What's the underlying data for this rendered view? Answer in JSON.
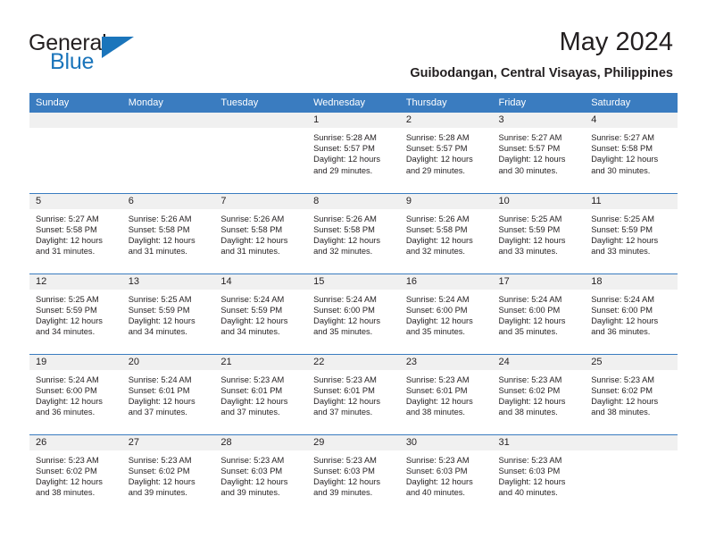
{
  "brand": {
    "line1": "General",
    "line2": "Blue",
    "flag_color": "#1b75bb"
  },
  "header": {
    "title": "May 2024",
    "subtitle": "Guibodangan, Central Visayas, Philippines",
    "accent_color": "#3a7cc0",
    "daynum_bg": "#f0f0f0"
  },
  "weekday_headers": [
    "Sunday",
    "Monday",
    "Tuesday",
    "Wednesday",
    "Thursday",
    "Friday",
    "Saturday"
  ],
  "labels": {
    "sunrise_prefix": "Sunrise:",
    "sunset_prefix": "Sunset:",
    "daylight_prefix": "Daylight:"
  },
  "weeks": [
    [
      {
        "day": "",
        "empty": true
      },
      {
        "day": "",
        "empty": true
      },
      {
        "day": "",
        "empty": true
      },
      {
        "day": "1",
        "sunrise": "Sunrise: 5:28 AM",
        "sunset": "Sunset: 5:57 PM",
        "daylight": "Daylight: 12 hours and 29 minutes."
      },
      {
        "day": "2",
        "sunrise": "Sunrise: 5:28 AM",
        "sunset": "Sunset: 5:57 PM",
        "daylight": "Daylight: 12 hours and 29 minutes."
      },
      {
        "day": "3",
        "sunrise": "Sunrise: 5:27 AM",
        "sunset": "Sunset: 5:57 PM",
        "daylight": "Daylight: 12 hours and 30 minutes."
      },
      {
        "day": "4",
        "sunrise": "Sunrise: 5:27 AM",
        "sunset": "Sunset: 5:58 PM",
        "daylight": "Daylight: 12 hours and 30 minutes."
      }
    ],
    [
      {
        "day": "5",
        "sunrise": "Sunrise: 5:27 AM",
        "sunset": "Sunset: 5:58 PM",
        "daylight": "Daylight: 12 hours and 31 minutes."
      },
      {
        "day": "6",
        "sunrise": "Sunrise: 5:26 AM",
        "sunset": "Sunset: 5:58 PM",
        "daylight": "Daylight: 12 hours and 31 minutes."
      },
      {
        "day": "7",
        "sunrise": "Sunrise: 5:26 AM",
        "sunset": "Sunset: 5:58 PM",
        "daylight": "Daylight: 12 hours and 31 minutes."
      },
      {
        "day": "8",
        "sunrise": "Sunrise: 5:26 AM",
        "sunset": "Sunset: 5:58 PM",
        "daylight": "Daylight: 12 hours and 32 minutes."
      },
      {
        "day": "9",
        "sunrise": "Sunrise: 5:26 AM",
        "sunset": "Sunset: 5:58 PM",
        "daylight": "Daylight: 12 hours and 32 minutes."
      },
      {
        "day": "10",
        "sunrise": "Sunrise: 5:25 AM",
        "sunset": "Sunset: 5:59 PM",
        "daylight": "Daylight: 12 hours and 33 minutes."
      },
      {
        "day": "11",
        "sunrise": "Sunrise: 5:25 AM",
        "sunset": "Sunset: 5:59 PM",
        "daylight": "Daylight: 12 hours and 33 minutes."
      }
    ],
    [
      {
        "day": "12",
        "sunrise": "Sunrise: 5:25 AM",
        "sunset": "Sunset: 5:59 PM",
        "daylight": "Daylight: 12 hours and 34 minutes."
      },
      {
        "day": "13",
        "sunrise": "Sunrise: 5:25 AM",
        "sunset": "Sunset: 5:59 PM",
        "daylight": "Daylight: 12 hours and 34 minutes."
      },
      {
        "day": "14",
        "sunrise": "Sunrise: 5:24 AM",
        "sunset": "Sunset: 5:59 PM",
        "daylight": "Daylight: 12 hours and 34 minutes."
      },
      {
        "day": "15",
        "sunrise": "Sunrise: 5:24 AM",
        "sunset": "Sunset: 6:00 PM",
        "daylight": "Daylight: 12 hours and 35 minutes."
      },
      {
        "day": "16",
        "sunrise": "Sunrise: 5:24 AM",
        "sunset": "Sunset: 6:00 PM",
        "daylight": "Daylight: 12 hours and 35 minutes."
      },
      {
        "day": "17",
        "sunrise": "Sunrise: 5:24 AM",
        "sunset": "Sunset: 6:00 PM",
        "daylight": "Daylight: 12 hours and 35 minutes."
      },
      {
        "day": "18",
        "sunrise": "Sunrise: 5:24 AM",
        "sunset": "Sunset: 6:00 PM",
        "daylight": "Daylight: 12 hours and 36 minutes."
      }
    ],
    [
      {
        "day": "19",
        "sunrise": "Sunrise: 5:24 AM",
        "sunset": "Sunset: 6:00 PM",
        "daylight": "Daylight: 12 hours and 36 minutes."
      },
      {
        "day": "20",
        "sunrise": "Sunrise: 5:24 AM",
        "sunset": "Sunset: 6:01 PM",
        "daylight": "Daylight: 12 hours and 37 minutes."
      },
      {
        "day": "21",
        "sunrise": "Sunrise: 5:23 AM",
        "sunset": "Sunset: 6:01 PM",
        "daylight": "Daylight: 12 hours and 37 minutes."
      },
      {
        "day": "22",
        "sunrise": "Sunrise: 5:23 AM",
        "sunset": "Sunset: 6:01 PM",
        "daylight": "Daylight: 12 hours and 37 minutes."
      },
      {
        "day": "23",
        "sunrise": "Sunrise: 5:23 AM",
        "sunset": "Sunset: 6:01 PM",
        "daylight": "Daylight: 12 hours and 38 minutes."
      },
      {
        "day": "24",
        "sunrise": "Sunrise: 5:23 AM",
        "sunset": "Sunset: 6:02 PM",
        "daylight": "Daylight: 12 hours and 38 minutes."
      },
      {
        "day": "25",
        "sunrise": "Sunrise: 5:23 AM",
        "sunset": "Sunset: 6:02 PM",
        "daylight": "Daylight: 12 hours and 38 minutes."
      }
    ],
    [
      {
        "day": "26",
        "sunrise": "Sunrise: 5:23 AM",
        "sunset": "Sunset: 6:02 PM",
        "daylight": "Daylight: 12 hours and 38 minutes."
      },
      {
        "day": "27",
        "sunrise": "Sunrise: 5:23 AM",
        "sunset": "Sunset: 6:02 PM",
        "daylight": "Daylight: 12 hours and 39 minutes."
      },
      {
        "day": "28",
        "sunrise": "Sunrise: 5:23 AM",
        "sunset": "Sunset: 6:03 PM",
        "daylight": "Daylight: 12 hours and 39 minutes."
      },
      {
        "day": "29",
        "sunrise": "Sunrise: 5:23 AM",
        "sunset": "Sunset: 6:03 PM",
        "daylight": "Daylight: 12 hours and 39 minutes."
      },
      {
        "day": "30",
        "sunrise": "Sunrise: 5:23 AM",
        "sunset": "Sunset: 6:03 PM",
        "daylight": "Daylight: 12 hours and 40 minutes."
      },
      {
        "day": "31",
        "sunrise": "Sunrise: 5:23 AM",
        "sunset": "Sunset: 6:03 PM",
        "daylight": "Daylight: 12 hours and 40 minutes."
      },
      {
        "day": "",
        "empty": true
      }
    ]
  ]
}
